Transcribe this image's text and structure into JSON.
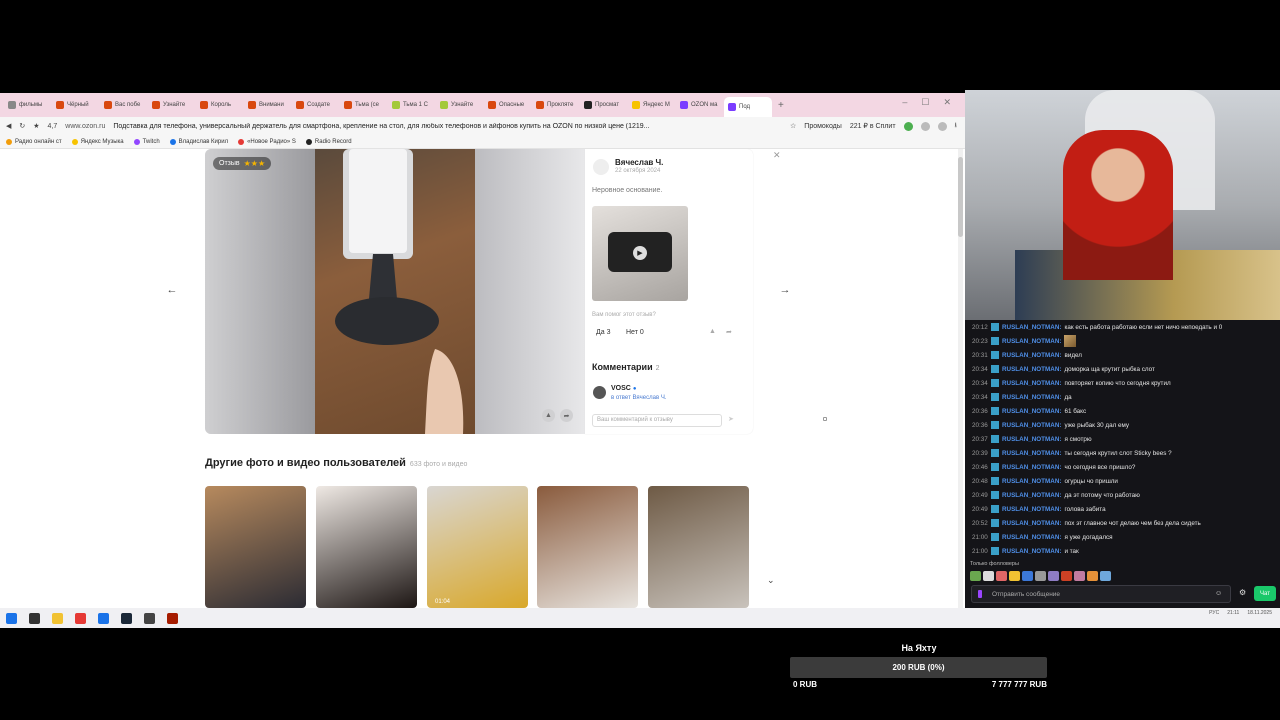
{
  "browser": {
    "tabs": [
      {
        "label": "фильмы",
        "color": "#888888"
      },
      {
        "label": "Чёрный",
        "color": "#d9480f"
      },
      {
        "label": "Вас побе",
        "color": "#d9480f"
      },
      {
        "label": "Узнайте",
        "color": "#d9480f"
      },
      {
        "label": "Король",
        "color": "#d9480f"
      },
      {
        "label": "Внимани",
        "color": "#d9480f"
      },
      {
        "label": "Создате",
        "color": "#d9480f"
      },
      {
        "label": "Тьма (се",
        "color": "#d9480f"
      },
      {
        "label": "Тьма 1 С",
        "color": "#a3c93a"
      },
      {
        "label": "Узнайте",
        "color": "#a3c93a"
      },
      {
        "label": "Опасные",
        "color": "#d9480f"
      },
      {
        "label": "Прокляте",
        "color": "#d9480f"
      },
      {
        "label": "Просмат",
        "color": "#222222"
      },
      {
        "label": "Яндекс М",
        "color": "#f7c300"
      },
      {
        "label": "OZON ма",
        "color": "#7a3cff"
      },
      {
        "label": "Под",
        "color": "#7a3cff"
      }
    ],
    "new_tab": "+",
    "rating": "4,7",
    "url": "www.ozon.ru",
    "page_title": "Подставка для телефона, универсальный держатель для смартфона, крепление на стол, для любых телефонов и айфонов купить на OZON по низкой цене (1219...",
    "promo_label": "Промокоды",
    "cashback_label": "221 ₽ в Сплит",
    "bookmarks": [
      {
        "label": "Радио онлайн ст",
        "color": "#f29d0b"
      },
      {
        "label": "Яндекс Музыка",
        "color": "#f7c300"
      },
      {
        "label": "Twitch",
        "color": "#9146ff"
      },
      {
        "label": "Владислав Кирил",
        "color": "#1a73e8"
      },
      {
        "label": "«Новое Радио» S",
        "color": "#e53935"
      },
      {
        "label": "Radio Record",
        "color": "#222222"
      }
    ]
  },
  "review": {
    "badge_label": "Отзыв",
    "stars": "★★★",
    "author": "Вячеслав Ч.",
    "date": "22 октября 2024",
    "text": "Неровное основание.",
    "helpful_question": "Вам помог этот отзыв?",
    "yes_label": "Да 3",
    "no_label": "Нет 0",
    "comments_title": "Комментарии",
    "comments_count": "2",
    "comment_author": "VOSC",
    "comment_reply": "в ответ Вячеслав Ч.",
    "comment_placeholder": "Ваш комментарий к отзыву"
  },
  "gallery": {
    "title": "Другие фото и видео пользователей",
    "count": "633 фото и видео",
    "video_badge": "01:04",
    "thumbs": [
      {
        "colors": [
          "#b78a5e",
          "#2b2b33"
        ]
      },
      {
        "colors": [
          "#efe9e4",
          "#1d1614"
        ]
      },
      {
        "colors": [
          "#d9d6d2",
          "#d9a82a"
        ]
      },
      {
        "colors": [
          "#8a5b3d",
          "#e8e4df"
        ]
      },
      {
        "colors": [
          "#6e5a45",
          "#c9c3bc"
        ]
      }
    ]
  },
  "taskbar": {
    "icons": [
      "windows-icon",
      "search-icon",
      "folder-icon",
      "yandex-icon",
      "browser-icon",
      "steam-icon",
      "obs-icon",
      "app-icon"
    ],
    "time": "21:11",
    "date": "18.11.2025",
    "lang": "РУС"
  },
  "chat": {
    "messages": [
      {
        "time": "20:12",
        "user": "RUSLAN_NOTMAN:",
        "text": "как есть работа работаю если нет ничо непоедать и 0"
      },
      {
        "time": "20:23",
        "user": "RUSLAN_NOTMAN:",
        "text": "",
        "emote": true
      },
      {
        "time": "20:31",
        "user": "RUSLAN_NOTMAN:",
        "text": "видел"
      },
      {
        "time": "20:34",
        "user": "RUSLAN_NOTMAN:",
        "text": "доморка ща крутит рыбка слот"
      },
      {
        "time": "20:34",
        "user": "RUSLAN_NOTMAN:",
        "text": "повторяет копию что сегодня крутил"
      },
      {
        "time": "20:34",
        "user": "RUSLAN_NOTMAN:",
        "text": "да"
      },
      {
        "time": "20:36",
        "user": "RUSLAN_NOTMAN:",
        "text": "61 бакс"
      },
      {
        "time": "20:36",
        "user": "RUSLAN_NOTMAN:",
        "text": "уже рыбак 30 дал ему"
      },
      {
        "time": "20:37",
        "user": "RUSLAN_NOTMAN:",
        "text": "я смотрю"
      },
      {
        "time": "20:39",
        "user": "RUSLAN_NOTMAN:",
        "text": "ты сегодня крутил слот Sticky bees ?"
      },
      {
        "time": "20:46",
        "user": "RUSLAN_NOTMAN:",
        "text": "чо сегодня все пришло?"
      },
      {
        "time": "20:48",
        "user": "RUSLAN_NOTMAN:",
        "text": "огурцы чо пришли"
      },
      {
        "time": "20:49",
        "user": "RUSLAN_NOTMAN:",
        "text": "да эт потому что работаю"
      },
      {
        "time": "20:49",
        "user": "RUSLAN_NOTMAN:",
        "text": "голова забита"
      },
      {
        "time": "20:52",
        "user": "RUSLAN_NOTMAN:",
        "text": "пох эт главное чот делаю чем без дела сидеть"
      },
      {
        "time": "21:00",
        "user": "RUSLAN_NOTMAN:",
        "text": "я уже догадался"
      },
      {
        "time": "21:00",
        "user": "RUSLAN_NOTMAN:",
        "text": "и так"
      }
    ],
    "followers_only": "Только фолловеры",
    "emote_colors": [
      "#6aa84f",
      "#dddddd",
      "#e06666",
      "#f1c232",
      "#3c78d8",
      "#999999",
      "#8e7cc3",
      "#cc4125",
      "#c27ba0",
      "#e69138",
      "#6fa8dc"
    ],
    "input_placeholder": "Отправить сообщение",
    "send_label": "Чат"
  },
  "goal": {
    "title": "На Яхту",
    "progress_label": "200 RUB (0%)",
    "progress_fraction": 0,
    "min_label": "0 RUB",
    "max_label": "7 777 777 RUB"
  }
}
